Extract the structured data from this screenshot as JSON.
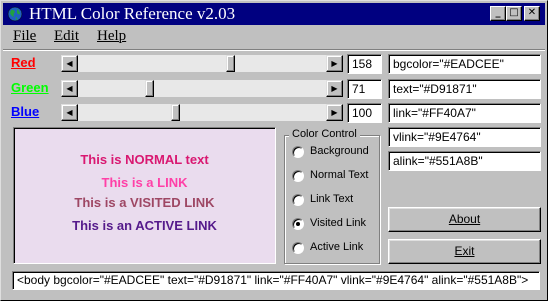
{
  "window": {
    "title": "HTML Color Reference v2.03",
    "controls": [
      "_",
      "□",
      "✕"
    ]
  },
  "menu": {
    "file": "File",
    "edit": "Edit",
    "help": "Help"
  },
  "sliders": [
    {
      "label": "Red",
      "value": "158",
      "fraction": 0.62,
      "color": "#ff0000"
    },
    {
      "label": "Green",
      "value": "71",
      "fraction": 0.28,
      "color": "#00ff00"
    },
    {
      "label": "Blue",
      "value": "100",
      "fraction": 0.39,
      "color": "#0000ff"
    }
  ],
  "attributes": {
    "bgcolor": "bgcolor=\"#EADCEE\"",
    "text": "text=\"#D91871\"",
    "link": "link=\"#FF40A7\"",
    "vlink": "vlink=\"#9E4764\"",
    "alink": "alink=\"#551A8B\""
  },
  "preview": {
    "background": "#EADCEE",
    "normal_text": "This is NORMAL text",
    "normal_color": "#D91871",
    "link_text": "This is a LINK",
    "link_color": "#FF40A7",
    "visited_text": "This is a VISITED LINK",
    "visited_color": "#9E4764",
    "active_text": "This is an ACTIVE LINK",
    "active_color": "#551A8B"
  },
  "color_control": {
    "title": "Color Control",
    "options": [
      "Background",
      "Normal Text",
      "Link Text",
      "Visited Link",
      "Active Link"
    ],
    "selected": "Visited Link"
  },
  "buttons": {
    "about": "About",
    "exit": "Exit"
  },
  "body_tag": "<body bgcolor=\"#EADCEE\" text=\"#D91871\" link=\"#FF40A7\" vlink=\"#9E4764\" alink=\"#551A8B\">"
}
